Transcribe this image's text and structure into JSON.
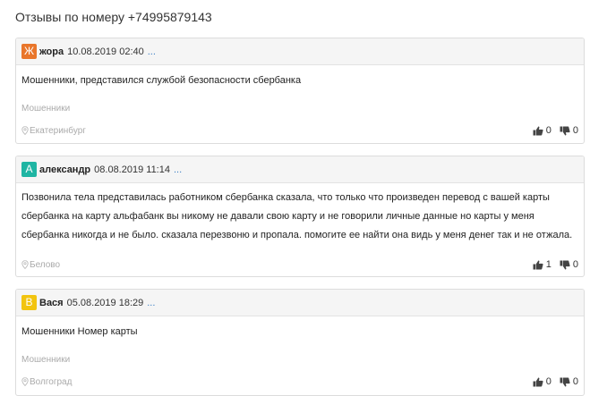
{
  "page": {
    "title": "Отзывы по номеру +74995879143"
  },
  "reviews": [
    {
      "avatar_letter": "Ж",
      "avatar_color": "#e9762b",
      "author": "жора",
      "date": "10.08.2019 02:40",
      "more": "...",
      "text": "Мошенники, представился службой безопасности сбербанка",
      "tag": "Мошенники",
      "city": "Екатеринбург",
      "likes": "0",
      "dislikes": "0"
    },
    {
      "avatar_letter": "А",
      "avatar_color": "#1fb5a3",
      "author": "александр",
      "date": "08.08.2019 11:14",
      "more": "...",
      "text": "Позвонила тела представилась работником сбербанка сказала, что только что произведен перевод с вашей карты сбербанка на карту альфабанк вы никому не давали свою карту и не говорили личные данные но карты у меня сбербанка никогда и не было. сказала перезвоню и пропала. помогите ее найти она видь у меня денег так и не отжала.",
      "tag": "",
      "city": "Белово",
      "likes": "1",
      "dislikes": "0"
    },
    {
      "avatar_letter": "В",
      "avatar_color": "#f2c40f",
      "author": "Вася",
      "date": "05.08.2019 18:29",
      "more": "...",
      "text": "Мошенники Номер карты",
      "tag": "Мошенники",
      "city": "Волгоград",
      "likes": "0",
      "dislikes": "0"
    }
  ]
}
